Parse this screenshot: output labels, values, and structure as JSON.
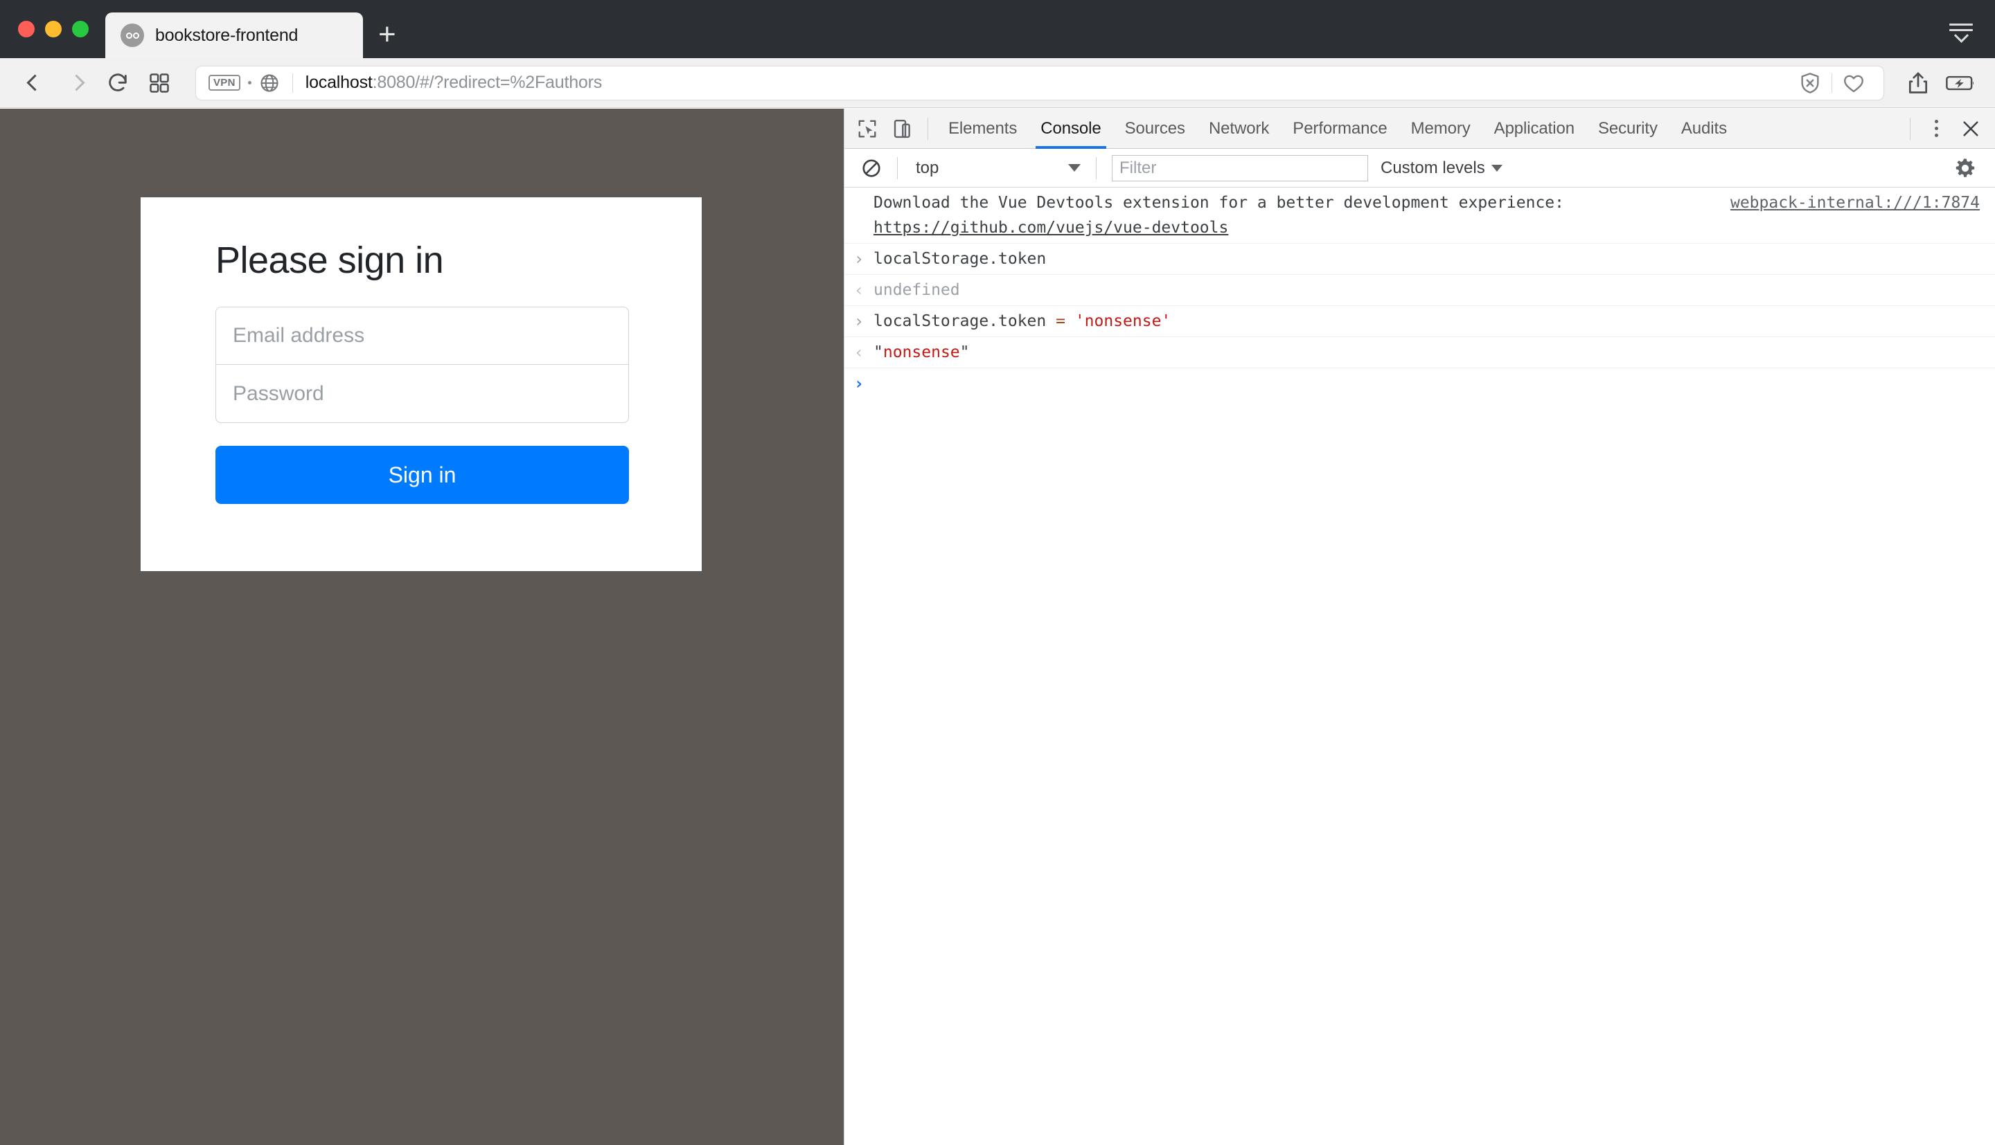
{
  "browser": {
    "window_controls": [
      "close",
      "minimize",
      "maximize"
    ],
    "tab": {
      "title": "bookstore-frontend",
      "favicon": "bookstore-favicon"
    },
    "new_tab_label": "+",
    "toolbar": {
      "back_icon": "back-chevron-icon",
      "forward_icon": "forward-chevron-icon",
      "reload_icon": "reload-icon",
      "tab_overview_icon": "tab-overview-icon",
      "vpn_badge": "VPN",
      "globe_icon": "globe-icon",
      "url_host": "localhost",
      "url_rest": ":8080/#/?redirect=%2Fauthors",
      "url_full": "localhost:8080/#/?redirect=%2Fauthors",
      "shield_icon": "shield-block-icon",
      "favorite_icon": "heart-icon",
      "share_icon": "share-icon",
      "battery_icon": "battery-charging-icon",
      "all_tabs_icon": "show-all-tabs-icon"
    }
  },
  "page": {
    "background_color": "#5d5853",
    "card_background": "#ffffff",
    "signin": {
      "title": "Please sign in",
      "email_placeholder": "Email address",
      "password_placeholder": "Password",
      "email_value": "",
      "password_value": "",
      "submit_label": "Sign in",
      "submit_color": "#007bff"
    }
  },
  "devtools": {
    "inspect_icon": "inspect-element-icon",
    "device_icon": "toggle-device-toolbar-icon",
    "tabs": [
      {
        "label": "Elements",
        "active": false
      },
      {
        "label": "Console",
        "active": true
      },
      {
        "label": "Sources",
        "active": false
      },
      {
        "label": "Network",
        "active": false
      },
      {
        "label": "Performance",
        "active": false
      },
      {
        "label": "Memory",
        "active": false
      },
      {
        "label": "Application",
        "active": false
      },
      {
        "label": "Security",
        "active": false
      },
      {
        "label": "Audits",
        "active": false
      }
    ],
    "active_tab_underline_color": "#1a73e8",
    "more_icon": "kebab-menu-icon",
    "close_icon": "close-icon",
    "filterbar": {
      "clear_icon": "clear-console-icon",
      "context": "top",
      "context_caret": "chevron-down-icon",
      "filter_placeholder": "Filter",
      "filter_value": "",
      "levels_label": "Custom levels",
      "levels_caret": "chevron-down-icon",
      "settings_icon": "gear-icon"
    },
    "console": {
      "entries": [
        {
          "gutter": "",
          "gutter_kind": "none",
          "text": "Download the Vue Devtools extension for a better development experience:",
          "link": "https://github.com/vuejs/vue-devtools",
          "source": "webpack-internal:///1:7874",
          "kind": "log"
        },
        {
          "gutter": "›",
          "gutter_kind": "in",
          "text": "localStorage.token",
          "kind": "input"
        },
        {
          "gutter": "‹",
          "gutter_kind": "out",
          "text": "undefined",
          "kind": "output-dim"
        },
        {
          "gutter": "›",
          "gutter_kind": "in",
          "text": "localStorage.token = 'nonsense'",
          "parts": [
            {
              "t": "localStorage.token ",
              "c": "plain"
            },
            {
              "t": "= ",
              "c": "op"
            },
            {
              "t": "'nonsense'",
              "c": "str"
            }
          ],
          "kind": "input"
        },
        {
          "gutter": "‹",
          "gutter_kind": "out",
          "text": "\"nonsense\"",
          "parts": [
            {
              "t": "\"",
              "c": "plain"
            },
            {
              "t": "nonsense",
              "c": "str"
            },
            {
              "t": "\"",
              "c": "plain"
            }
          ],
          "kind": "output"
        },
        {
          "gutter": "›",
          "gutter_kind": "prompt",
          "text": "",
          "kind": "prompt"
        }
      ]
    }
  }
}
